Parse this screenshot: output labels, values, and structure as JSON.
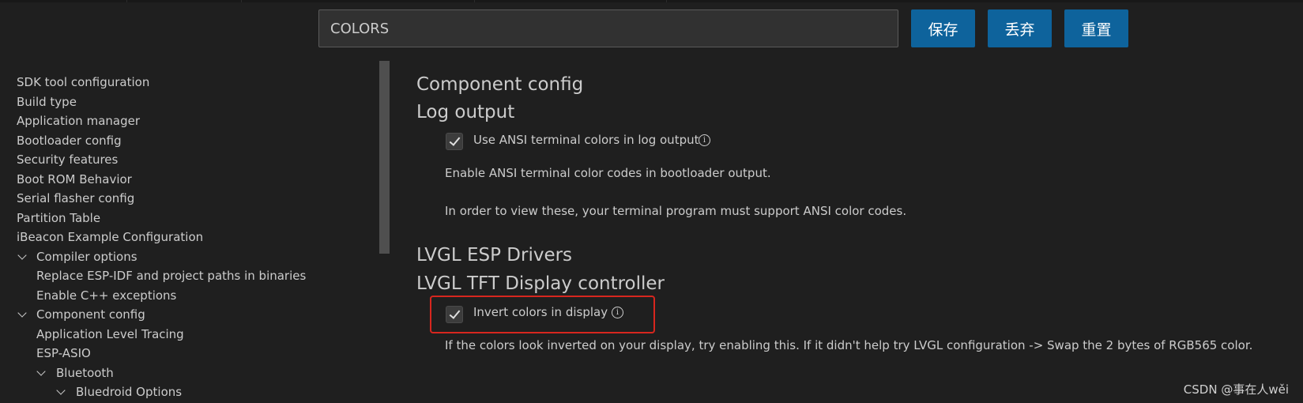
{
  "toolbar": {
    "search_value": "COLORS",
    "save_label": "保存",
    "discard_label": "丢弃",
    "reset_label": "重置"
  },
  "sidebar": {
    "items": [
      {
        "label": "SDK tool configuration",
        "level": 0,
        "expanded": null
      },
      {
        "label": "Build type",
        "level": 0,
        "expanded": null
      },
      {
        "label": "Application manager",
        "level": 0,
        "expanded": null
      },
      {
        "label": "Bootloader config",
        "level": 0,
        "expanded": null
      },
      {
        "label": "Security features",
        "level": 0,
        "expanded": null
      },
      {
        "label": "Boot ROM Behavior",
        "level": 0,
        "expanded": null
      },
      {
        "label": "Serial flasher config",
        "level": 0,
        "expanded": null
      },
      {
        "label": "Partition Table",
        "level": 0,
        "expanded": null
      },
      {
        "label": "iBeacon Example Configuration",
        "level": 0,
        "expanded": null
      },
      {
        "label": "Compiler options",
        "level": 1,
        "expanded": true
      },
      {
        "label": "Replace ESP-IDF and project paths in binaries",
        "level": 1,
        "expanded": null
      },
      {
        "label": "Enable C++ exceptions",
        "level": 1,
        "expanded": null
      },
      {
        "label": "Component config",
        "level": 1,
        "expanded": true
      },
      {
        "label": "Application Level Tracing",
        "level": 1,
        "expanded": null
      },
      {
        "label": "ESP-ASIO",
        "level": 1,
        "expanded": null
      },
      {
        "label": "Bluetooth",
        "level": 2,
        "expanded": true
      },
      {
        "label": "Bluedroid Options",
        "level": 3,
        "expanded": true
      }
    ]
  },
  "content": {
    "section1": {
      "title": "Component config",
      "subtitle": "Log output",
      "option_label": "Use ANSI terminal colors in log output",
      "option_checked": true,
      "desc1": "Enable ANSI terminal color codes in bootloader output.",
      "desc2": "In order to view these, your terminal program must support ANSI color codes."
    },
    "section2": {
      "title": "LVGL ESP Drivers",
      "subtitle": "LVGL TFT Display controller",
      "option_label": "Invert colors in display",
      "option_checked": true,
      "desc": "If the colors look inverted on your display, try enabling this. If it didn't help try LVGL configuration -> Swap the 2 bytes of RGB565 color."
    }
  },
  "info_glyph": "i",
  "watermark": "CSDN @事在人wěi",
  "colors": {
    "background": "#1f1f1f",
    "button": "#0e639c",
    "highlight_box": "#d7261e",
    "text": "#cccccc"
  }
}
